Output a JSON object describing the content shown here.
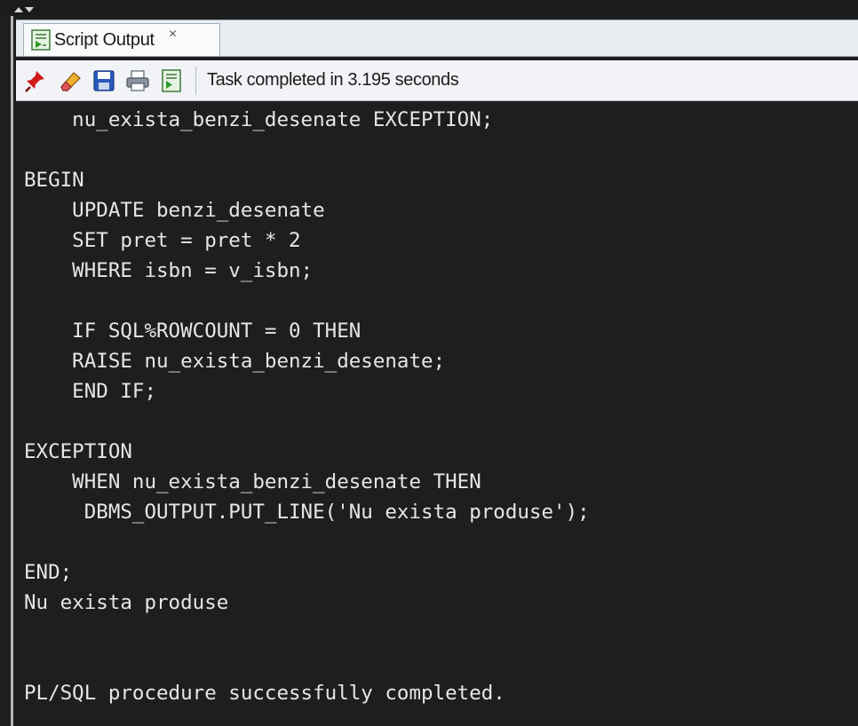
{
  "panel": {
    "tab_title": "Script Output",
    "tab_close": "×",
    "tab_icon": "script-output-icon"
  },
  "toolbar": {
    "buttons": [
      {
        "icon": "pin-icon",
        "color": "#cc1b1b"
      },
      {
        "icon": "eraser-icon",
        "color": "#e0a020"
      },
      {
        "icon": "save-icon",
        "color": "#1d4fa8"
      },
      {
        "icon": "print-icon",
        "color": "#6d7480"
      },
      {
        "icon": "open-script-icon",
        "color": "#2f8f2f"
      }
    ],
    "status": "Task completed in 3.195 seconds"
  },
  "output": {
    "lines": [
      "    nu_exista_benzi_desenate EXCEPTION;",
      "",
      "BEGIN",
      "    UPDATE benzi_desenate",
      "    SET pret = pret * 2",
      "    WHERE isbn = v_isbn;",
      "",
      "    IF SQL%ROWCOUNT = 0 THEN",
      "    RAISE nu_exista_benzi_desenate;",
      "    END IF;",
      "",
      "EXCEPTION",
      "    WHEN nu_exista_benzi_desenate THEN",
      "     DBMS_OUTPUT.PUT_LINE('Nu exista produse');",
      "",
      "END;",
      "Nu exista produse",
      "",
      "",
      "PL/SQL procedure successfully completed."
    ]
  }
}
